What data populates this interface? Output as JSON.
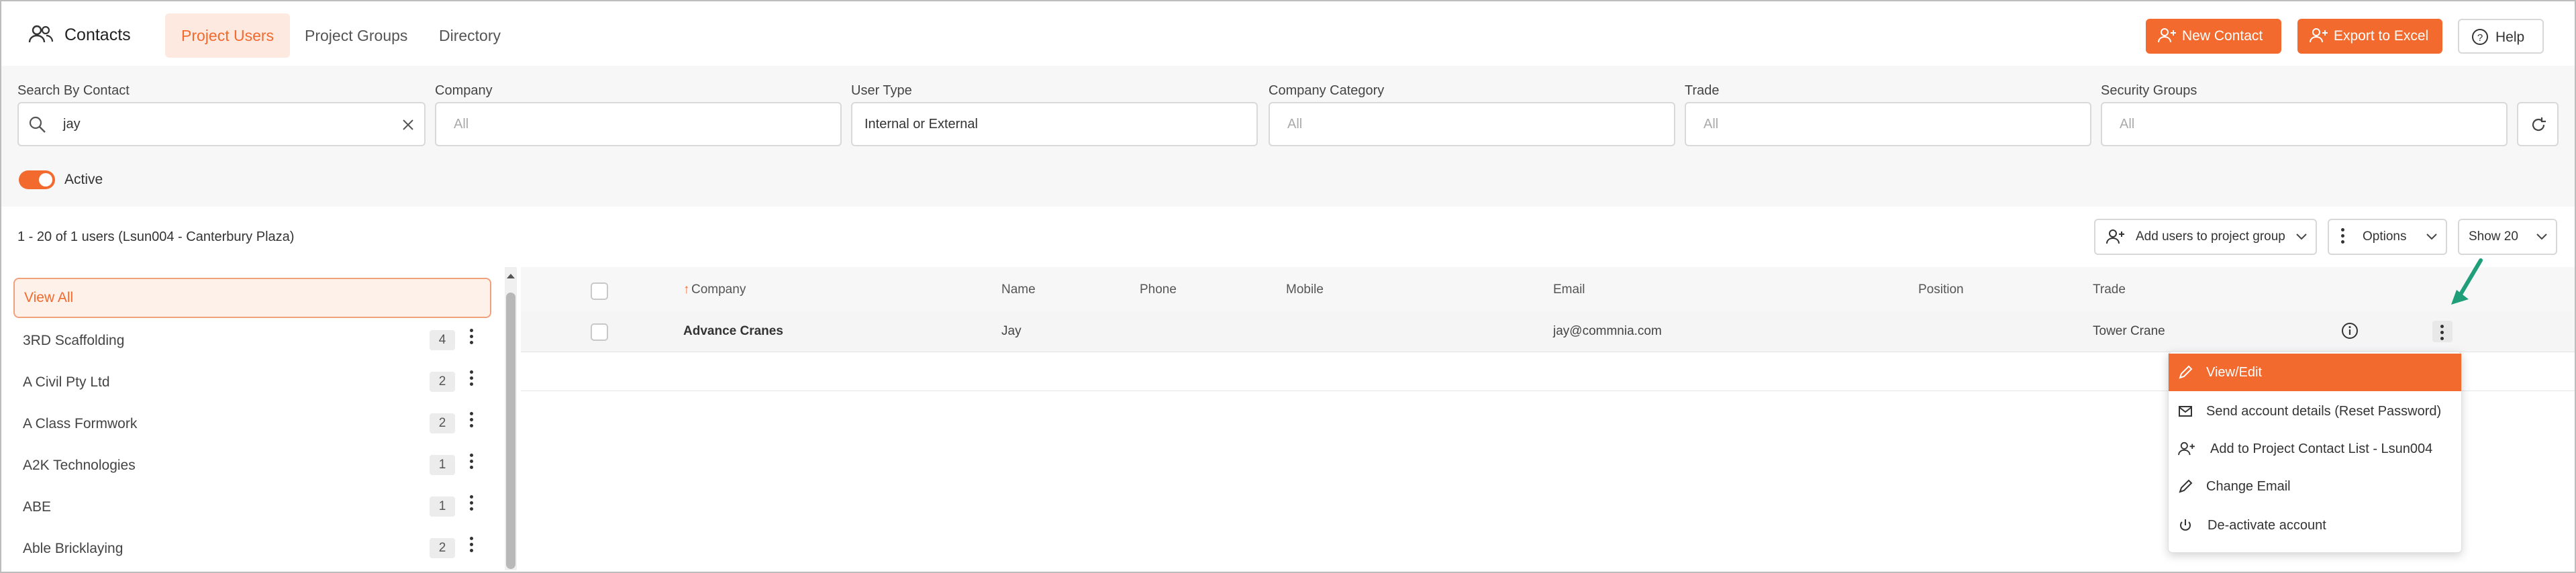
{
  "app": {
    "title": "Contacts"
  },
  "tabs": [
    {
      "label": "Project Users",
      "active": true
    },
    {
      "label": "Project Groups",
      "active": false
    },
    {
      "label": "Directory",
      "active": false
    }
  ],
  "header_actions": {
    "new_contact": "New Contact",
    "export": "Export to Excel",
    "help": "Help"
  },
  "filters": {
    "search": {
      "label": "Search By Contact",
      "value": "jay"
    },
    "company": {
      "label": "Company",
      "placeholder": "All"
    },
    "user_type": {
      "label": "User Type",
      "value": "Internal or External"
    },
    "company_category": {
      "label": "Company Category",
      "placeholder": "All"
    },
    "trade": {
      "label": "Trade",
      "placeholder": "All"
    },
    "security_groups": {
      "label": "Security Groups",
      "placeholder": "All"
    },
    "active_label": "Active",
    "active_on": true
  },
  "results": {
    "count_text": "1 - 20 of 1 users (Lsun004 - Canterbury Plaza)",
    "add_to_group": "Add users to project group",
    "options": "Options",
    "show": "Show 20"
  },
  "sidebar": {
    "view_all": "View All",
    "items": [
      {
        "label": "3RD Scaffolding",
        "count": "4"
      },
      {
        "label": "A Civil Pty Ltd",
        "count": "2"
      },
      {
        "label": "A Class Formwork",
        "count": "2"
      },
      {
        "label": "A2K Technologies",
        "count": "1"
      },
      {
        "label": "ABE",
        "count": "1"
      },
      {
        "label": "Able Bricklaying",
        "count": "2"
      }
    ]
  },
  "table": {
    "sort_arrow": "↑",
    "columns": [
      "Company",
      "Name",
      "Phone",
      "Mobile",
      "Email",
      "Position",
      "Trade"
    ],
    "rows": [
      {
        "company": "Advance Cranes",
        "name": "Jay",
        "phone": "",
        "mobile": "",
        "email": "jay@commnia.com",
        "position": "",
        "trade": "Tower Crane"
      }
    ]
  },
  "row_menu": {
    "items": [
      {
        "label": "View/Edit",
        "icon": "pencil-icon",
        "active": true
      },
      {
        "label": "Send account details (Reset Password)",
        "icon": "envelope-icon"
      },
      {
        "label": "Add to Project Contact List - Lsun004",
        "icon": "add-user-icon"
      },
      {
        "label": "Change Email",
        "icon": "pencil-icon"
      },
      {
        "label": "De-activate account",
        "icon": "power-icon"
      }
    ]
  },
  "colors": {
    "accent": "#f26a2e",
    "annotation_arrow": "#1f9e7a"
  }
}
